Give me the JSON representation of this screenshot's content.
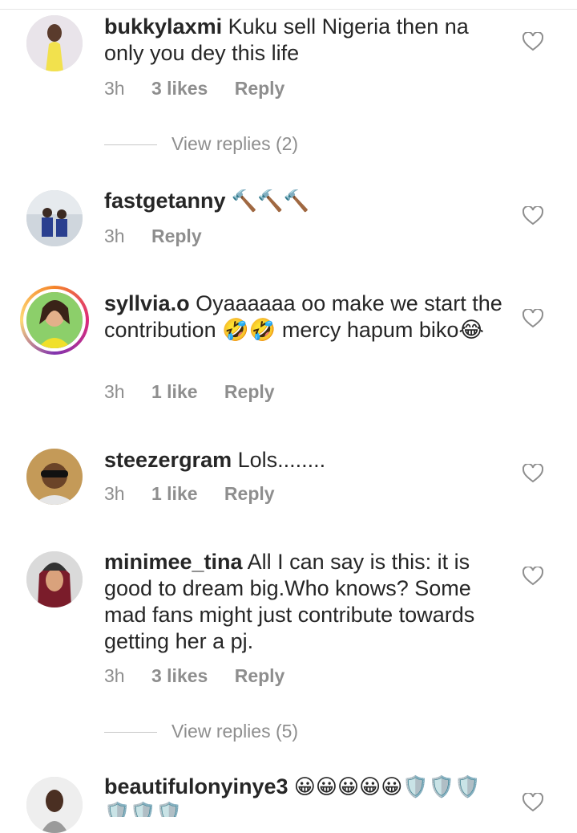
{
  "comments": [
    {
      "user": "bukkylaxmi",
      "text": " Kuku sell Nigeria then na only you dey this life",
      "time": "3h",
      "likes": "3 likes",
      "reply": "Reply",
      "view_replies": "View replies (2)"
    },
    {
      "user": "fastgetanny",
      "text": " 🔨🔨🔨",
      "time": "3h",
      "likes": "",
      "reply": "Reply"
    },
    {
      "user": "syllvia.o",
      "text": " Oyaaaaaa oo make we start the contribution 🤣🤣 mercy hapum biko😂",
      "time": "3h",
      "likes": "1 like",
      "reply": "Reply"
    },
    {
      "user": "steezergram",
      "text": " Lols........",
      "time": "3h",
      "likes": "1 like",
      "reply": "Reply"
    },
    {
      "user": "minimee_tina",
      "text": " All I can say is this: it is good to dream big.Who knows? Some mad fans might just contribute towards getting her a pj.",
      "time": "3h",
      "likes": "3 likes",
      "reply": "Reply",
      "view_replies": "View replies (5)"
    },
    {
      "user": "beautifulonyinye3",
      "text": " 😀😀😀😀😀🛡️🛡️🛡️🛡️🛡️🛡️"
    }
  ],
  "icons": {
    "heart": "heart-outline-icon",
    "avatar": "user-avatar"
  },
  "colors": {
    "text": "#262626",
    "muted": "#8e8e8e",
    "story_ring": "#dd2a7b"
  }
}
